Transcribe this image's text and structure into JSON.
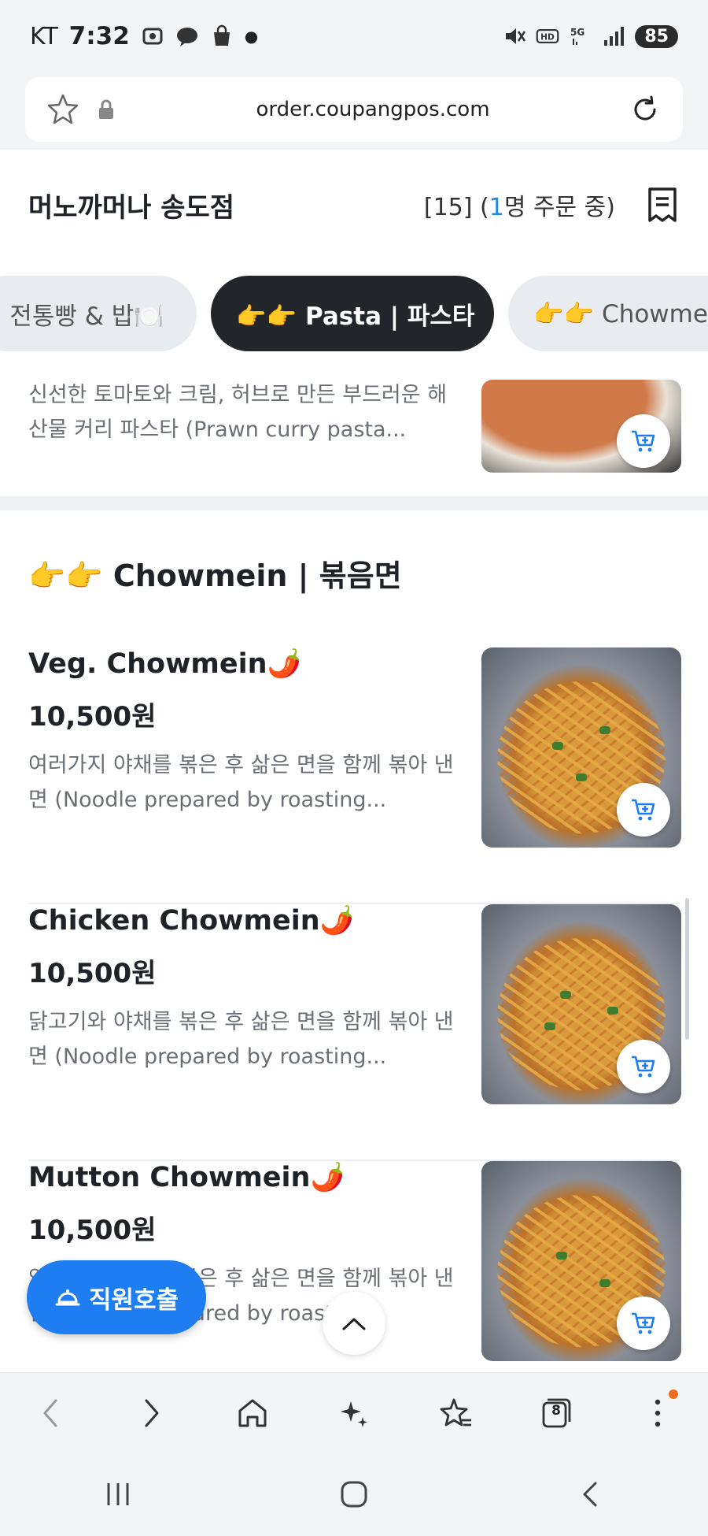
{
  "status_bar": {
    "carrier": "KT",
    "time": "7:32",
    "battery": "85"
  },
  "url_bar": {
    "url": "order.coupangpos.com"
  },
  "header": {
    "store_name": "머노까머나 송도점",
    "order_prefix": "[15] (",
    "order_count": "1",
    "order_suffix": "명 주문 중)"
  },
  "tabs": [
    {
      "label": "| 전통빵 & 밥🍽️"
    },
    {
      "label": "👉👉 Pasta | 파스타"
    },
    {
      "label": "👉👉 Chowmein"
    }
  ],
  "prev_item": {
    "desc": "신선한 토마토와 크림, 허브로 만든 부드러운 해산물 커리 파스타 (Prawn curry pasta..."
  },
  "section": {
    "title": "👉👉 Chowmein | 볶음면"
  },
  "items": [
    {
      "name": "Veg. Chowmein🌶️",
      "price": "10,500원",
      "desc": "여러가지 야채를 볶은 후 삶은 면을 함께 볶아 낸 면 (Noodle prepared by roasting..."
    },
    {
      "name": "Chicken Chowmein🌶️",
      "price": "10,500원",
      "desc": "닭고기와 야채를 볶은 후 삶은 면을 함께 볶아 낸 면 (Noodle prepared by roasting..."
    },
    {
      "name": "Mutton Chowmein🌶️",
      "price": "10,500원",
      "desc": "양고기와 야채를 볶은 후 삶은 면을 함께 볶아 낸 면 (Noodle prepared by roasting..."
    }
  ],
  "floating": {
    "staff_call": "직원호출"
  },
  "toolbar": {
    "tabs_count": "8"
  },
  "colors": {
    "accent": "#1e7df0",
    "tab_active": "#22262b"
  }
}
